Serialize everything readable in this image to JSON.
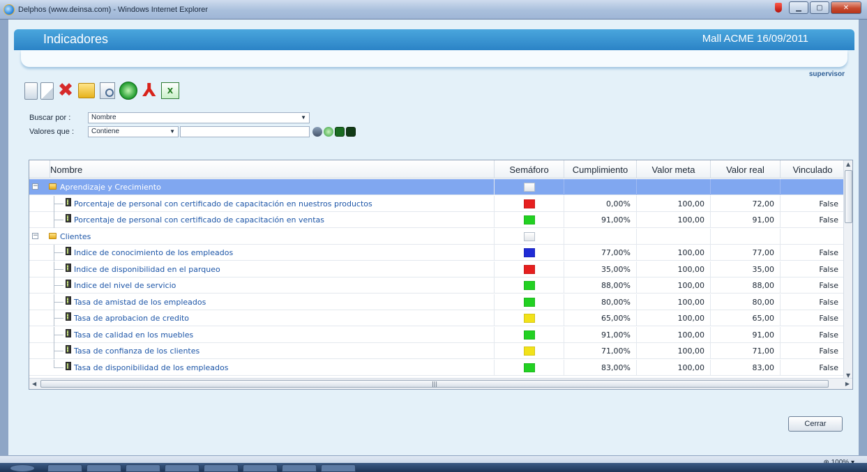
{
  "window": {
    "title": "Delphos (www.deinsa.com) - Windows Internet Explorer"
  },
  "header": {
    "title": "Indicadores",
    "right_text": "Mall ACME 16/09/2011",
    "user": "supervisor"
  },
  "toolbar": {
    "buttons": [
      "new-icon",
      "edit-icon",
      "delete-icon",
      "folder-icon",
      "preview-icon",
      "refresh-icon",
      "pdf-icon",
      "excel-icon"
    ]
  },
  "search": {
    "buscar_label": "Buscar por :",
    "buscar_value": "Nombre",
    "valores_label": "Valores que :",
    "valores_value": "Contiene",
    "text_value": ""
  },
  "grid": {
    "columns": [
      "Nombre",
      "Semáforo",
      "Cumplimiento",
      "Valor meta",
      "Valor real",
      "Vinculado"
    ],
    "rows": [
      {
        "type": "group",
        "name": "Aprendizaje y Crecimiento",
        "light": "#ffffff",
        "cumplimiento": "",
        "meta": "",
        "real": "",
        "vinculado": "",
        "selected": true
      },
      {
        "type": "item",
        "name": "Porcentaje de personal con certificado de capacitación en nuestros productos",
        "light": "#e61f1f",
        "cumplimiento": "0,00%",
        "meta": "100,00",
        "real": "72,00",
        "vinculado": "False"
      },
      {
        "type": "item",
        "name": "Porcentaje de personal con certificado de capacitación en ventas",
        "light": "#22d122",
        "cumplimiento": "91,00%",
        "meta": "100,00",
        "real": "91,00",
        "vinculado": "False"
      },
      {
        "type": "group",
        "name": "Clientes",
        "light": "#ffffff",
        "cumplimiento": "",
        "meta": "",
        "real": "",
        "vinculado": ""
      },
      {
        "type": "item",
        "name": "Indice de conocimiento de los empleados",
        "light": "#1f2bd6",
        "cumplimiento": "77,00%",
        "meta": "100,00",
        "real": "77,00",
        "vinculado": "False"
      },
      {
        "type": "item",
        "name": "Indice de disponibilidad en el parqueo",
        "light": "#e61f1f",
        "cumplimiento": "35,00%",
        "meta": "100,00",
        "real": "35,00",
        "vinculado": "False"
      },
      {
        "type": "item",
        "name": "Indice del nivel de servicio",
        "light": "#22d122",
        "cumplimiento": "88,00%",
        "meta": "100,00",
        "real": "88,00",
        "vinculado": "False"
      },
      {
        "type": "item",
        "name": "Tasa de amistad de los empleados",
        "light": "#22d122",
        "cumplimiento": "80,00%",
        "meta": "100,00",
        "real": "80,00",
        "vinculado": "False"
      },
      {
        "type": "item",
        "name": "Tasa de aprobacion de credito",
        "light": "#f2e21a",
        "cumplimiento": "65,00%",
        "meta": "100,00",
        "real": "65,00",
        "vinculado": "False"
      },
      {
        "type": "item",
        "name": "Tasa de calidad en los muebles",
        "light": "#22d122",
        "cumplimiento": "91,00%",
        "meta": "100,00",
        "real": "91,00",
        "vinculado": "False"
      },
      {
        "type": "item",
        "name": "Tasa de confianza de los clientes",
        "light": "#f2e21a",
        "cumplimiento": "71,00%",
        "meta": "100,00",
        "real": "71,00",
        "vinculado": "False"
      },
      {
        "type": "item",
        "name": "Tasa de disponibilidad de los empleados",
        "light": "#22d122",
        "cumplimiento": "83,00%",
        "meta": "100,00",
        "real": "83,00",
        "vinculado": "False"
      }
    ]
  },
  "buttons": {
    "close": "Cerrar"
  },
  "status": {
    "zoom": "100%"
  }
}
